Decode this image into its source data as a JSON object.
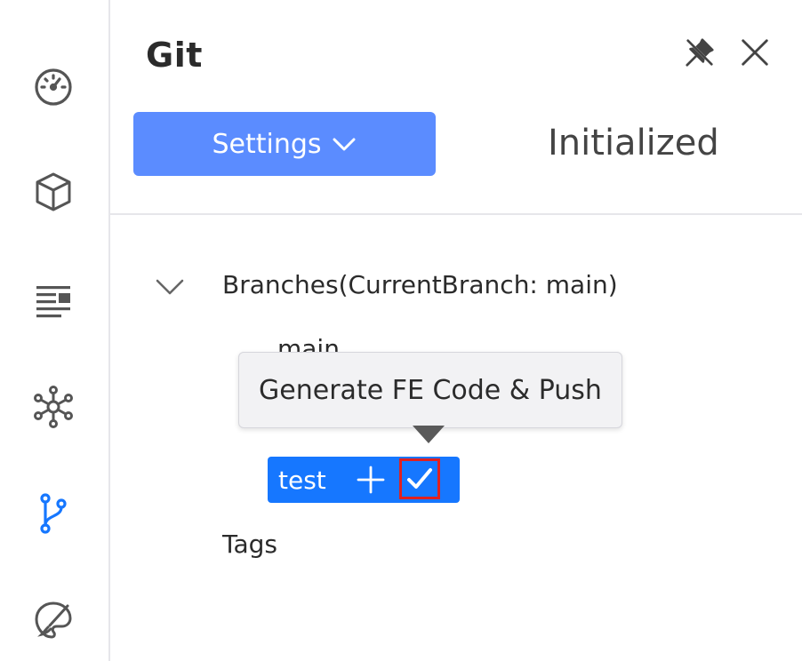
{
  "activity_bar": {
    "items": [
      {
        "icon": "dashboard-gauge-icon"
      },
      {
        "icon": "cube-icon"
      },
      {
        "icon": "document-list-icon"
      },
      {
        "icon": "network-hub-icon"
      },
      {
        "icon": "git-branch-icon",
        "active": true
      },
      {
        "icon": "palette-brush-icon"
      }
    ],
    "active_color": "#1677ff"
  },
  "panel": {
    "title": "Git",
    "pin_icon": "pin-icon",
    "close_icon": "close-icon",
    "settings_label": "Settings",
    "settings_chevron_icon": "chevron-down-icon",
    "status": "Initialized",
    "accent_color": "#5b8cff"
  },
  "tree": {
    "branches_label": "Branches(CurrentBranch: main)",
    "branches": [
      {
        "name": "main"
      },
      {
        "name": "test",
        "selected": true
      }
    ],
    "tags_label": "Tags"
  },
  "tooltip": {
    "text": "Generate FE Code & Push"
  },
  "branch_actions": {
    "add_icon": "plus-icon",
    "confirm_icon": "check-icon",
    "highlight_color": "#e02020"
  }
}
